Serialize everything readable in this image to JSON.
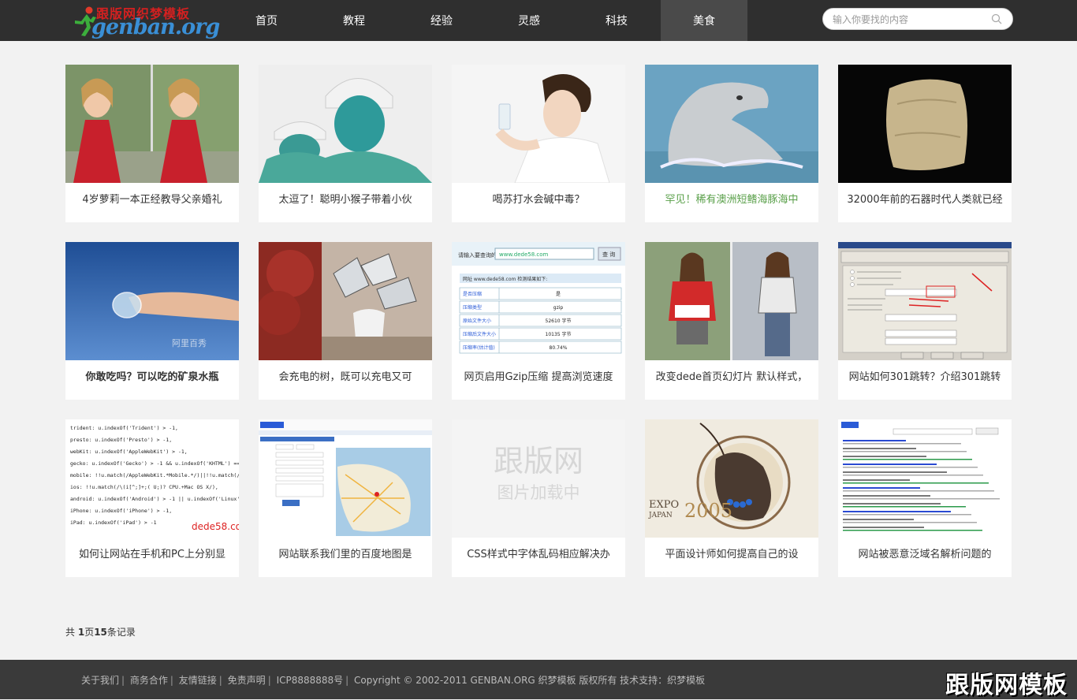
{
  "header": {
    "logo_top": "跟版网织梦模板",
    "logo_main": "genban.org",
    "nav": [
      "首页",
      "教程",
      "经验",
      "灵感",
      "科技",
      "美食"
    ],
    "active_nav": 5,
    "search_placeholder": "输入你要找的内容"
  },
  "cards": [
    {
      "title": "4岁萝莉一本正经教导父亲婚礼"
    },
    {
      "title": "太逗了！聪明小猴子带着小伙"
    },
    {
      "title": "喝苏打水会碱中毒？"
    },
    {
      "title": "罕见！稀有澳洲短鳍海豚海中"
    },
    {
      "title": "32000年前的石器时代人类就已经"
    },
    {
      "title": "你敢吃吗？可以吃的矿泉水瓶"
    },
    {
      "title": "会充电的树，既可以充电又可"
    },
    {
      "title": "网页启用Gzip压缩 提高浏览速度"
    },
    {
      "title": "改变dede首页幻灯片 默认样式，"
    },
    {
      "title": "网站如何301跳转？介绍301跳转"
    },
    {
      "title": "如何让网站在手机和PC上分别显"
    },
    {
      "title": "网站联系我们里的百度地图是"
    },
    {
      "title": "CSS样式中字体乱码相应解决办"
    },
    {
      "title": "平面设计师如何提高自己的设"
    },
    {
      "title": "网站被恶意泛域名解析问题的"
    }
  ],
  "placeholder_image": {
    "line1": "跟版网",
    "line2": "图片加载中"
  },
  "code_lines": [
    "trident: u.indexOf('Trident') > -1,",
    "presto: u.indexOf('Presto') > -1,",
    "webKit: u.indexOf('AppleWebKit') > -1,",
    "gecko: u.indexOf('Gecko') > -1 && u.indexOf('KHTML') == -1,",
    "mobile: !!u.match(/AppleWebKit.*Mobile.*/)||!!u.match(/AppleWebKit/),",
    "ios: !!u.match(/\\(i[^;]+;( U;)? CPU.+Mac OS X/),",
    "android: u.indexOf('Android') > -1 || u.indexOf('Linux') > -1,",
    "iPhone: u.indexOf('iPhone') > -1,",
    "iPad: u.indexOf('iPad') > -1"
  ],
  "code_brand": "dede58.com",
  "gzip_table": {
    "url_label": "请输入要查询的网址:",
    "url_value": "www.dede58.com",
    "button": "查 询",
    "result_title": "网址 www.dede58.com 检测结果如下:",
    "rows": [
      [
        "是否压缩",
        "是"
      ],
      [
        "压缩类型",
        "gzip"
      ],
      [
        "原始文件大小",
        "52610 字节"
      ],
      [
        "压缩后文件大小",
        "10135 字节"
      ],
      [
        "压缩率(估计值)",
        "80.74%"
      ]
    ]
  },
  "expo_text": {
    "line1": "EXPO",
    "year": "2005",
    "line2": "JAPAN"
  },
  "watermark_text": "阿里百秀",
  "pager": {
    "prefix": "共 ",
    "pages": "1",
    "mid": "页",
    "count": "15",
    "suffix": "条记录"
  },
  "footer": {
    "links": [
      "关于我们",
      "商务合作",
      "友情链接",
      "免责声明",
      "ICP8888888号"
    ],
    "copyright": "Copyright © 2002-2011 GENBAN.ORG 织梦模板 版权所有 技术支持：织梦模板",
    "brand_watermark": "跟版网模板"
  },
  "colors": {
    "header_bg": "#2f2f2f",
    "active_nav_bg": "#4a4a4a",
    "page_bg": "#f2f2f2",
    "highlight_title": "#5aa04a",
    "footer_bg": "#3a3a3a"
  }
}
